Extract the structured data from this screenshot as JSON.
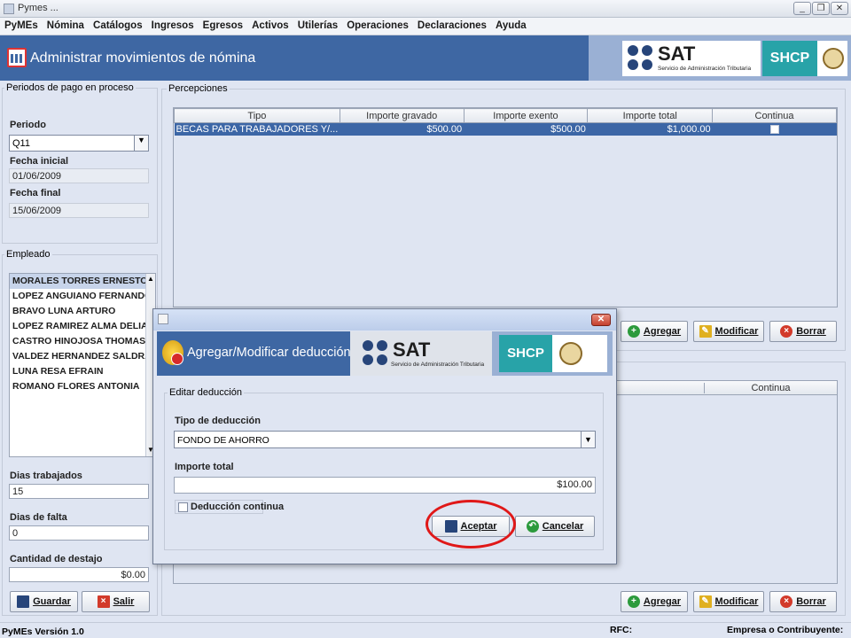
{
  "window": {
    "title": "Pymes ...",
    "minimize": "_",
    "maximize": "❐",
    "close": "✕"
  },
  "menu": [
    "PyMEs",
    "Nómina",
    "Catálogos",
    "Ingresos",
    "Egresos",
    "Activos",
    "Utilerías",
    "Operaciones",
    "Declaraciones",
    "Ayuda"
  ],
  "header": {
    "title": "Administrar movimientos de nómina"
  },
  "banner": {
    "sat": "SAT",
    "sat_sub": "Servicio de Administración Tributaria",
    "shcp": "SHCP"
  },
  "periods": {
    "section_title": "Periodos de pago en proceso",
    "period_label": "Periodo",
    "period_value": "Q11",
    "start_label": "Fecha inicial",
    "start_value": "01/06/2009",
    "end_label": "Fecha final",
    "end_value": "15/06/2009"
  },
  "employees": {
    "section_title": "Empleado",
    "items": [
      "MORALES TORRES ERNESTO",
      "LOPEZ ANGUIANO FERNANDO",
      "BRAVO LUNA ARTURO",
      "LOPEZ RAMIREZ ALMA DELIA",
      "CASTRO HINOJOSA THOMAS",
      "VALDEZ HERNANDEZ SALDRA",
      "LUNA RESA EFRAIN",
      "ROMANO FLORES ANTONIA"
    ]
  },
  "work": {
    "days_label": "Dias trabajados",
    "days_value": "15",
    "absence_label": "Dias de falta",
    "absence_value": "0",
    "piece_label": "Cantidad de destajo",
    "piece_value": "$0.00"
  },
  "bottom_buttons": {
    "save": "Guardar",
    "exit": "Salir"
  },
  "perceptions": {
    "section_title": "Percepciones",
    "columns": [
      "Tipo",
      "Importe gravado",
      "Importe exento",
      "Importe total",
      "Continua"
    ],
    "rows": [
      {
        "tipo": "BECAS PARA TRABAJADORES Y/...",
        "gravado": "$500.00",
        "exento": "$500.00",
        "total": "$1,000.00"
      }
    ],
    "add": "Agregar",
    "modify": "Modificar",
    "delete": "Borrar"
  },
  "deductions": {
    "columns_visible": [
      "Continua"
    ],
    "add": "Agregar",
    "modify": "Modificar",
    "delete": "Borrar"
  },
  "dialog": {
    "title": "Agregar/Modificar deducción",
    "group_title": "Editar deducción",
    "type_label": "Tipo de deducción",
    "type_value": "FONDO DE AHORRO",
    "amount_label": "Importe total",
    "amount_value": "$100.00",
    "continuous_label": "Deducción continua",
    "accept": "Aceptar",
    "cancel": "Cancelar"
  },
  "status": {
    "version": "PyMEs Versión 1.0",
    "rfc_label": "RFC:",
    "company_label": "Empresa o Contribuyente:"
  },
  "colors": {
    "header_blue": "#3e67a3",
    "banner_light": "#9ab0d4",
    "selection": "#3c66a6",
    "highlight_circle": "#e01818"
  }
}
